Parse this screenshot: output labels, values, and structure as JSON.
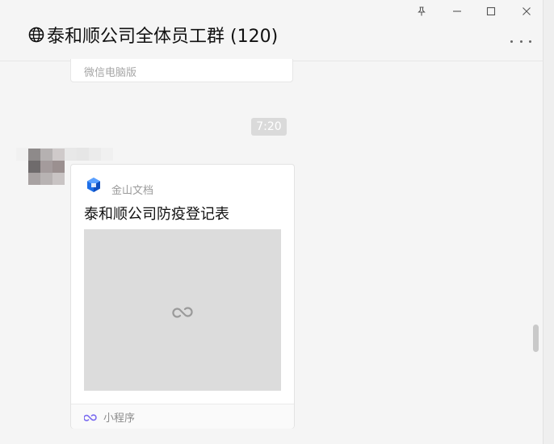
{
  "header": {
    "title": "泰和顺公司全体员工群 (120)",
    "title_icon": "globe-icon",
    "more_icon": "more-dots-icon"
  },
  "window_controls": {
    "pin_icon": "pin-icon",
    "minimize_icon": "minimize-icon",
    "maximize_icon": "maximize-icon",
    "close_icon": "close-icon"
  },
  "messages": {
    "previous": {
      "source_label": "微信电脑版"
    },
    "timestamp": "7:20",
    "mini_program_card": {
      "brand": "金山文档",
      "title": "泰和顺公司防疫登记表",
      "thumbnail_icon": "link-icon",
      "footer_label": "小程序",
      "footer_icon": "mini-program-icon"
    }
  },
  "colors": {
    "background": "#f5f5f5",
    "card_background": "#ffffff",
    "thumbnail_background": "#dcdcdc",
    "brand_blue": "#1e6fe8",
    "mini_program_purple": "#7b6cf0"
  }
}
